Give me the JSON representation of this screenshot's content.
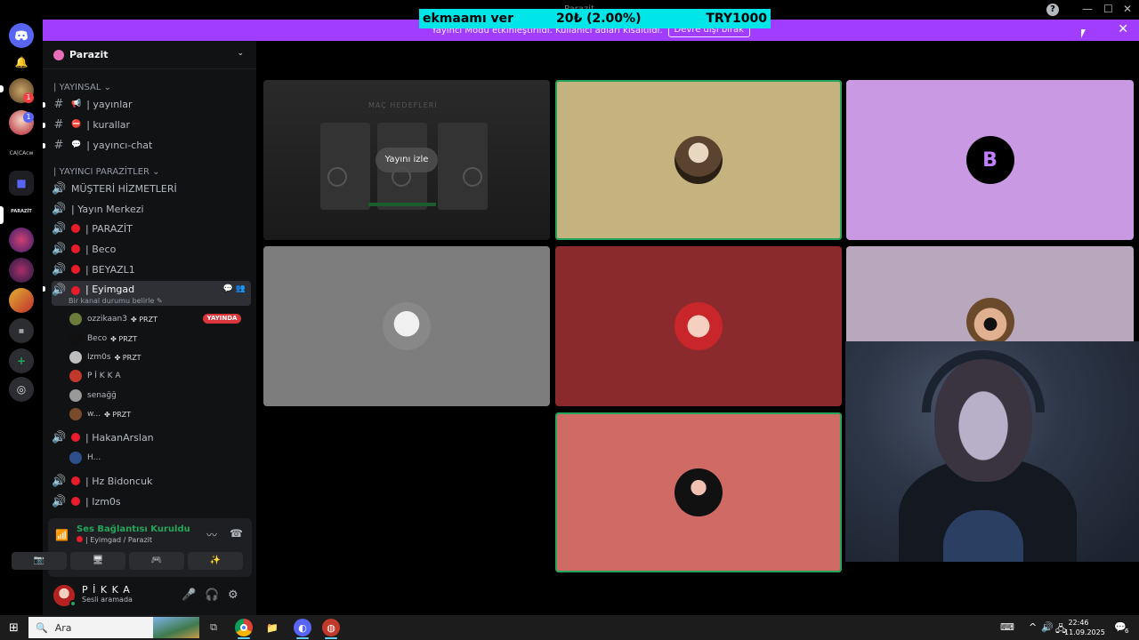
{
  "window": {
    "title": "Parazit",
    "help_glyph": "?",
    "min_glyph": "—",
    "max_glyph": "☐",
    "close_glyph": "✕"
  },
  "donation": {
    "name": "ekmaamı ver",
    "amount": "20₺ (2.00%)",
    "total": "TRY1000"
  },
  "notice": {
    "text": "Yayıncı Modu etkinleştirildi. Kullanıcı adları kısaltıldı.",
    "button": "Devre dışı bırak",
    "close": "✕"
  },
  "rail": {
    "badge_1": "1",
    "badge_2": "1",
    "label_server": "CA|CAcw",
    "label_parazit": "PARAZİT",
    "add": "+",
    "explore": "◎"
  },
  "server": {
    "name": "Parazit",
    "chevron": "⌄"
  },
  "categories": [
    {
      "label": "| YAYINSAL ⌄"
    },
    {
      "label": "| YAYINCI PARAZİTLER ⌄"
    }
  ],
  "text_channels": [
    {
      "icon": "📢",
      "name": "| yayınlar"
    },
    {
      "icon": "⛔",
      "name": "| kurallar"
    },
    {
      "icon": "💬",
      "name": "| yayıncı-chat"
    }
  ],
  "voice_channels": [
    {
      "name": "MÜŞTERİ HİZMETLERİ"
    },
    {
      "name": "| Yayın Merkezi"
    },
    {
      "name": "| PARAZİT"
    },
    {
      "name": "| Beco"
    },
    {
      "name": "| BEYAZL1"
    },
    {
      "name": "| Eyimgad"
    },
    {
      "name": "| HakanArslan"
    },
    {
      "name": "| Hz Bidoncuk"
    },
    {
      "name": "| Izm0s"
    }
  ],
  "active_channel": {
    "status": "Bir kanal durumu belirle ✎",
    "live_badge": "YAYINDA"
  },
  "members": [
    {
      "name": "ozzikaan3",
      "tag": "✤ PRZT",
      "color": "#6b7b3a"
    },
    {
      "name": "Beco",
      "tag": "✤ PRZT",
      "color": "#111111"
    },
    {
      "name": "Izm0s",
      "tag": "✤ PRZT",
      "color": "#bfbfbf"
    },
    {
      "name": "P İ K K A",
      "tag": "",
      "color": "#c0392b"
    },
    {
      "name": "senağğ",
      "tag": "",
      "color": "#999999"
    },
    {
      "name": "w...",
      "tag": "✤ PRZT",
      "color": "#7a4b2a"
    }
  ],
  "hakan_member": {
    "name": "H...",
    "color": "#2d4f8a"
  },
  "voice_panel": {
    "title": "Ses Bağlantısı Kuruldu",
    "subtitle": "| Eyimgad / Parazit",
    "signal": "📶",
    "noise": "〰",
    "hangup": "☎",
    "buttons": [
      "📷",
      "🖥",
      "🎮",
      "✨"
    ]
  },
  "user": {
    "name": "P İ K K A",
    "status": "Sesli aramada",
    "mic": "🎤",
    "headset": "🎧",
    "settings": "⚙"
  },
  "stream": {
    "title": "MAÇ HEDEFLERİ",
    "watch_label": "Yayını izle"
  },
  "tiles": {
    "c2": "#c4b27f",
    "c3": "#c99ae3",
    "c4": "#7d7d7d",
    "c5": "#8b2a2c",
    "c6": "#b8a7bd",
    "c7": "#cf6a64",
    "b_letter": "B"
  },
  "taskbar": {
    "start": "⊞",
    "search_icon": "🔍",
    "search_label": "Ara",
    "task_view": "⧉",
    "chrome": "◉",
    "files": "📁",
    "discord": "◐",
    "other": "◍",
    "tray_keyboard": "⌨",
    "tray_chevron": "^",
    "tray_volume": "🔊",
    "tray_net": "🖧",
    "time": "22:46",
    "date": "11.09.2025",
    "notif": "💬",
    "notif_count": "6"
  }
}
